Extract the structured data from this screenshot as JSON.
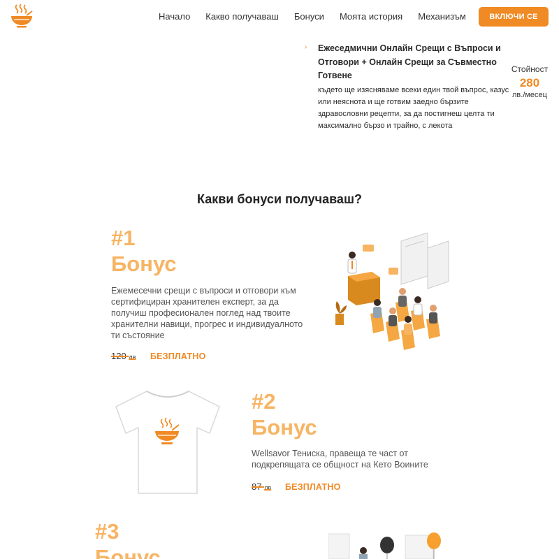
{
  "header": {
    "nav": [
      "Начало",
      "Какво получаваш",
      "Бонуси",
      "Моята история",
      "Механизъм"
    ],
    "cta_label": "ВКЛЮЧИ СЕ"
  },
  "feature": {
    "title": "Ежеседмични Онлайн Срещи с Въпроси и Отговори + Онлайн Срещи за Съвместно Готвене",
    "description": "където ще изясняваме всеки един твой въпрос, казус или неяснота и ще готвим заедно бързите здравословни рецепти, за да постигнеш целта ти максимално бързо и трайно, с лекота",
    "price_label": "Стойност",
    "price_value": "280",
    "price_unit": "лв./месец"
  },
  "bonuses": {
    "title": "Какви бонуси получаваш?",
    "items": [
      {
        "number": "#1",
        "word": "Бонус",
        "description": "Ежемесечни срещи с въпроси и отговори към сертифициран хранителен експерт, за да получиш професионален поглед над твоите хранителни навици, прогрес и индивидуалното ти състояние",
        "old_price": "120",
        "old_currency": "лв",
        "free": "БЕЗПЛАТНО"
      },
      {
        "number": "#2",
        "word": "Бонус",
        "description": "Wellsavor Тениска, правеща те част от подкрепящата се общност на Кето Воините",
        "old_price": "87",
        "old_currency": "лв",
        "free": "БЕЗПЛАТНО"
      },
      {
        "number": "#3",
        "word": "Бонус"
      }
    ]
  },
  "colors": {
    "accent": "#f08a24",
    "bonus_heading": "#f7b463"
  }
}
